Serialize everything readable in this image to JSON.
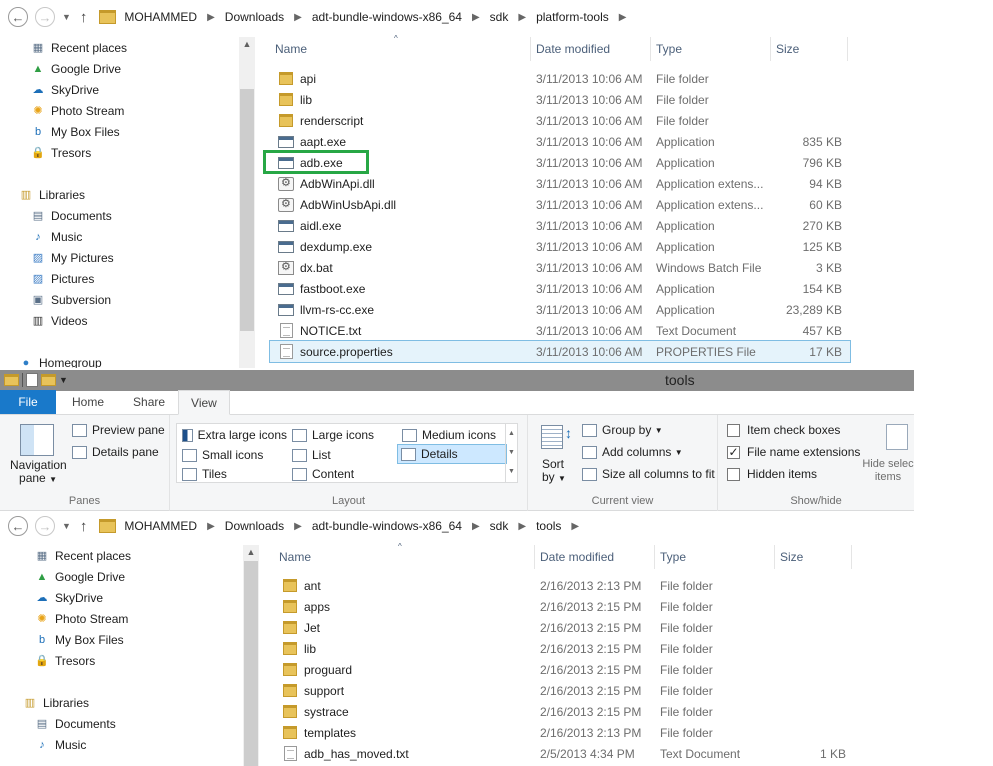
{
  "top_window": {
    "breadcrumb": [
      "MOHAMMED",
      "Downloads",
      "adt-bundle-windows-x86_64",
      "sdk",
      "platform-tools"
    ],
    "nav": {
      "favorites": [
        {
          "label": "Recent places",
          "icon": "recent-places-icon"
        },
        {
          "label": "Google Drive",
          "icon": "google-drive-icon"
        },
        {
          "label": "SkyDrive",
          "icon": "skydrive-icon"
        },
        {
          "label": "Photo Stream",
          "icon": "photo-stream-icon"
        },
        {
          "label": "My Box Files",
          "icon": "box-icon"
        },
        {
          "label": "Tresors",
          "icon": "lock-icon"
        }
      ],
      "libraries_label": "Libraries",
      "libraries": [
        {
          "label": "Documents",
          "icon": "documents-icon"
        },
        {
          "label": "Music",
          "icon": "music-icon"
        },
        {
          "label": "My Pictures",
          "icon": "pictures-icon"
        },
        {
          "label": "Pictures",
          "icon": "pictures-icon"
        },
        {
          "label": "Subversion",
          "icon": "subversion-icon"
        },
        {
          "label": "Videos",
          "icon": "videos-icon"
        }
      ],
      "homegroup_label": "Homegroup"
    },
    "columns": {
      "name": "Name",
      "date": "Date modified",
      "type": "Type",
      "size": "Size"
    },
    "files": [
      {
        "name": "api",
        "date": "3/11/2013 10:06 AM",
        "type": "File folder",
        "size": "",
        "kind": "folder"
      },
      {
        "name": "lib",
        "date": "3/11/2013 10:06 AM",
        "type": "File folder",
        "size": "",
        "kind": "folder"
      },
      {
        "name": "renderscript",
        "date": "3/11/2013 10:06 AM",
        "type": "File folder",
        "size": "",
        "kind": "folder"
      },
      {
        "name": "aapt.exe",
        "date": "3/11/2013 10:06 AM",
        "type": "Application",
        "size": "835 KB",
        "kind": "app"
      },
      {
        "name": "adb.exe",
        "date": "3/11/2013 10:06 AM",
        "type": "Application",
        "size": "796 KB",
        "kind": "app"
      },
      {
        "name": "AdbWinApi.dll",
        "date": "3/11/2013 10:06 AM",
        "type": "Application extens...",
        "size": "94 KB",
        "kind": "dll"
      },
      {
        "name": "AdbWinUsbApi.dll",
        "date": "3/11/2013 10:06 AM",
        "type": "Application extens...",
        "size": "60 KB",
        "kind": "dll"
      },
      {
        "name": "aidl.exe",
        "date": "3/11/2013 10:06 AM",
        "type": "Application",
        "size": "270 KB",
        "kind": "app"
      },
      {
        "name": "dexdump.exe",
        "date": "3/11/2013 10:06 AM",
        "type": "Application",
        "size": "125 KB",
        "kind": "app"
      },
      {
        "name": "dx.bat",
        "date": "3/11/2013 10:06 AM",
        "type": "Windows Batch File",
        "size": "3 KB",
        "kind": "bat"
      },
      {
        "name": "fastboot.exe",
        "date": "3/11/2013 10:06 AM",
        "type": "Application",
        "size": "154 KB",
        "kind": "app"
      },
      {
        "name": "llvm-rs-cc.exe",
        "date": "3/11/2013 10:06 AM",
        "type": "Application",
        "size": "23,289 KB",
        "kind": "app"
      },
      {
        "name": "NOTICE.txt",
        "date": "3/11/2013 10:06 AM",
        "type": "Text Document",
        "size": "457 KB",
        "kind": "txt"
      },
      {
        "name": "source.properties",
        "date": "3/11/2013 10:06 AM",
        "type": "PROPERTIES File",
        "size": "17 KB",
        "kind": "txt"
      }
    ]
  },
  "bottom_window": {
    "title": "tools",
    "tabs": [
      "File",
      "Home",
      "Share",
      "View"
    ],
    "ribbon": {
      "panes": {
        "navigation_pane": "Navigation",
        "navigation_pane_2": "pane",
        "preview_pane": "Preview pane",
        "details_pane": "Details pane",
        "group": "Panes"
      },
      "layout": {
        "extra_large": "Extra large icons",
        "large": "Large icons",
        "medium": "Medium icons",
        "small": "Small icons",
        "list": "List",
        "details": "Details",
        "tiles": "Tiles",
        "content": "Content",
        "group": "Layout"
      },
      "current_view": {
        "sort_by": "Sort",
        "sort_by_2": "by",
        "group_by": "Group by",
        "add_columns": "Add columns",
        "size_all": "Size all columns to fit",
        "group": "Current view"
      },
      "show_hide": {
        "item_check_boxes": "Item check boxes",
        "file_name_extensions": "File name extensions",
        "hidden_items": "Hidden items",
        "hide_selected": "Hide selec",
        "hide_selected_2": "items",
        "group": "Show/hide"
      }
    },
    "breadcrumb": [
      "MOHAMMED",
      "Downloads",
      "adt-bundle-windows-x86_64",
      "sdk",
      "tools"
    ],
    "nav": {
      "favorites": [
        {
          "label": "Recent places",
          "icon": "recent-places-icon"
        },
        {
          "label": "Google Drive",
          "icon": "google-drive-icon"
        },
        {
          "label": "SkyDrive",
          "icon": "skydrive-icon"
        },
        {
          "label": "Photo Stream",
          "icon": "photo-stream-icon"
        },
        {
          "label": "My Box Files",
          "icon": "box-icon"
        },
        {
          "label": "Tresors",
          "icon": "lock-icon"
        }
      ],
      "libraries_label": "Libraries",
      "libraries": [
        {
          "label": "Documents",
          "icon": "documents-icon"
        },
        {
          "label": "Music",
          "icon": "music-icon"
        }
      ]
    },
    "columns": {
      "name": "Name",
      "date": "Date modified",
      "type": "Type",
      "size": "Size"
    },
    "files": [
      {
        "name": "ant",
        "date": "2/16/2013 2:13 PM",
        "type": "File folder",
        "size": "",
        "kind": "folder"
      },
      {
        "name": "apps",
        "date": "2/16/2013 2:15 PM",
        "type": "File folder",
        "size": "",
        "kind": "folder"
      },
      {
        "name": "Jet",
        "date": "2/16/2013 2:15 PM",
        "type": "File folder",
        "size": "",
        "kind": "folder"
      },
      {
        "name": "lib",
        "date": "2/16/2013 2:15 PM",
        "type": "File folder",
        "size": "",
        "kind": "folder"
      },
      {
        "name": "proguard",
        "date": "2/16/2013 2:15 PM",
        "type": "File folder",
        "size": "",
        "kind": "folder"
      },
      {
        "name": "support",
        "date": "2/16/2013 2:15 PM",
        "type": "File folder",
        "size": "",
        "kind": "folder"
      },
      {
        "name": "systrace",
        "date": "2/16/2013 2:15 PM",
        "type": "File folder",
        "size": "",
        "kind": "folder"
      },
      {
        "name": "templates",
        "date": "2/16/2013 2:13 PM",
        "type": "File folder",
        "size": "",
        "kind": "folder"
      },
      {
        "name": "adb_has_moved.txt",
        "date": "2/5/2013 4:34 PM",
        "type": "Text Document",
        "size": "1 KB",
        "kind": "txt"
      }
    ]
  }
}
